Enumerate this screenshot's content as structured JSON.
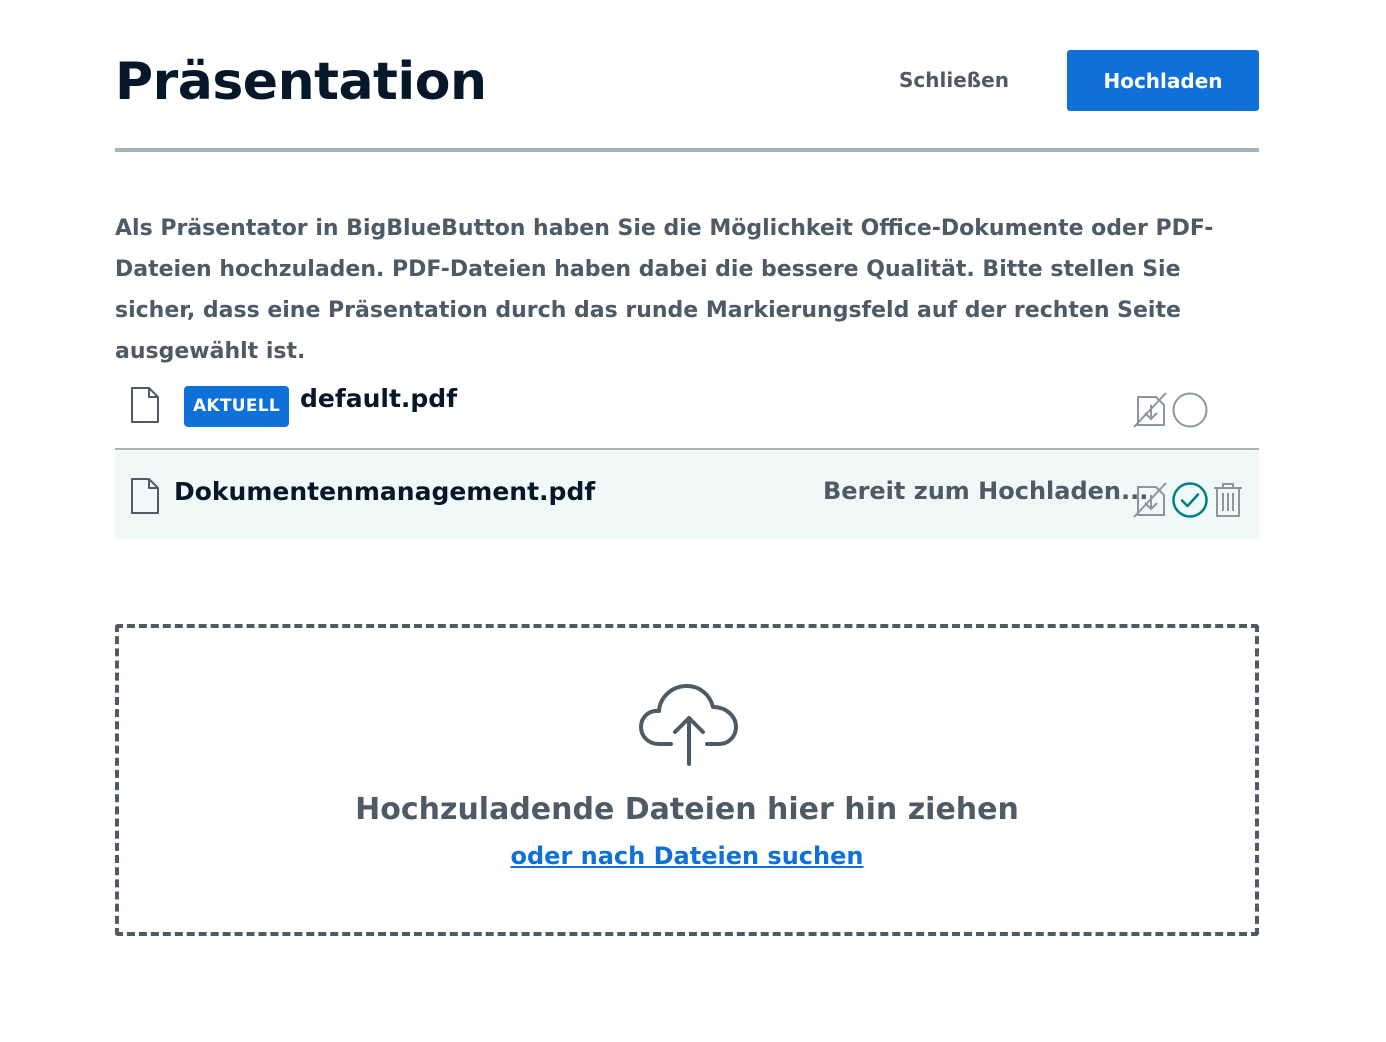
{
  "header": {
    "title": "Präsentation",
    "close_label": "Schließen",
    "upload_label": "Hochladen"
  },
  "description": "Als Präsentator in BigBlueButton haben Sie die Möglichkeit Office-Dokumente oder PDF-Dateien hochzuladen. PDF-Dateien haben dabei die bessere Qualität. Bitte stellen Sie sicher, dass eine Präsentation durch das runde Markierungsfeld auf der rechten Seite ausgewählt ist.",
  "files": [
    {
      "badge": "AKTUELL",
      "name": "default.pdf",
      "status": "",
      "selected": false,
      "icons": [
        "file-icon",
        "download-disabled-icon",
        "radio-unchecked-icon"
      ]
    },
    {
      "badge": "",
      "name": "Dokumentenmanagement.pdf",
      "status": "Bereit zum Hochladen...",
      "selected": true,
      "icons": [
        "file-icon",
        "download-disabled-icon",
        "radio-checked-icon",
        "trash-icon"
      ]
    }
  ],
  "dropzone": {
    "icon": "cloud-upload-icon",
    "title": "Hochzuladende Dateien hier hin ziehen",
    "link": "oder nach Dateien suchen"
  },
  "colors": {
    "primary": "#0f70d7",
    "text_dark": "#06172a",
    "text_gray": "#4e5a66",
    "divider": "#a7b3bd",
    "selected_row_bg": "#f0f8f8",
    "checked": "#008081"
  }
}
